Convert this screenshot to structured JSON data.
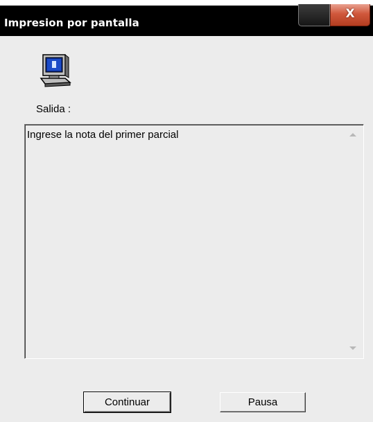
{
  "window": {
    "title": "Impresion por pantalla",
    "close_glyph": "X"
  },
  "icons": {
    "app": "computer-icon",
    "scroll_up": "scroll-up-arrow-icon",
    "scroll_down": "scroll-down-arrow-icon"
  },
  "output": {
    "label": "Salida :",
    "text": "Ingrese la nota del primer parcial"
  },
  "buttons": {
    "continue_label": "Continuar",
    "pause_label": "Pausa"
  },
  "colors": {
    "titlebar": "#000000",
    "close_button": "#c9502f",
    "window_bg": "#ececec"
  }
}
